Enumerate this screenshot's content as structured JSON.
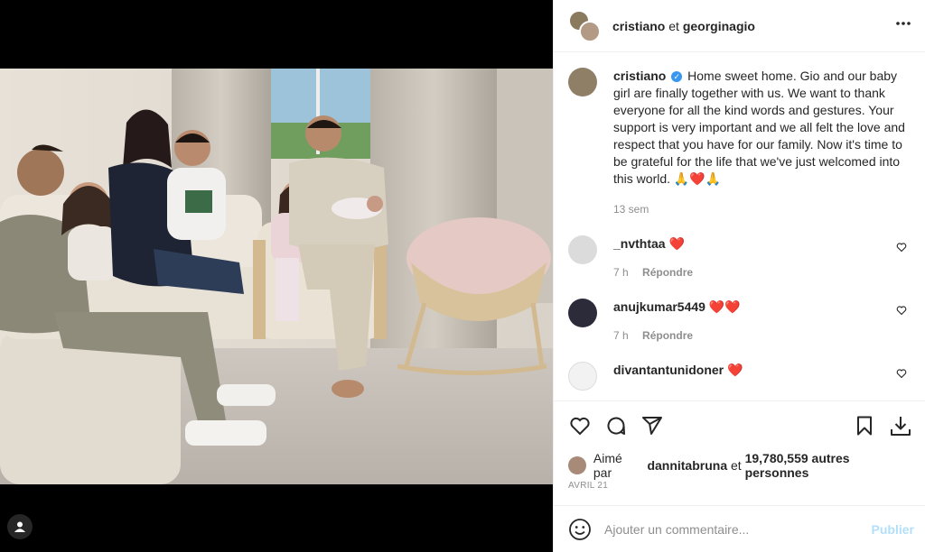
{
  "post_header": {
    "author_primary": "cristiano",
    "connector": "et",
    "author_secondary": "georginagio",
    "more_icon": "more-horizontal-icon"
  },
  "caption": {
    "username": "cristiano",
    "text": "Home sweet home. Gio and our baby girl are finally together with us. We want to thank everyone for all the kind words and gestures. Your support is very important and we all felt the love and respect that you have for our family. Now it's time to be grateful for the life that we've just welcomed into this world. 🙏❤️🙏",
    "time": "13 sem"
  },
  "comments": [
    {
      "username": "_nvthtaa",
      "text": "❤️",
      "time": "7 h",
      "reply_label": "Répondre",
      "avatar_color": "#dbdbdb"
    },
    {
      "username": "anujkumar5449",
      "text": "❤️❤️",
      "time": "7 h",
      "reply_label": "Répondre",
      "avatar_color": "#2b2b3a"
    },
    {
      "username": "divantantunidoner",
      "text": "❤️",
      "time": "",
      "reply_label": "",
      "avatar_color": "#f2f2f2"
    }
  ],
  "actions": {
    "like_icon": "heart-icon",
    "comment_icon": "comment-icon",
    "share_icon": "paper-plane-icon",
    "save_icon": "bookmark-icon",
    "download_icon": "download-icon"
  },
  "likes": {
    "prefix": "Aimé par",
    "user": "dannitabruna",
    "connector": "et",
    "others": "19,780,559 autres personnes"
  },
  "date": "AVRIL 21",
  "composer": {
    "placeholder": "Ajouter un commentaire...",
    "publish_label": "Publier"
  },
  "colors": {
    "accent_blue": "#3897f0",
    "publish_disabled": "#b2dffc",
    "heart_red": "#ed4956"
  }
}
